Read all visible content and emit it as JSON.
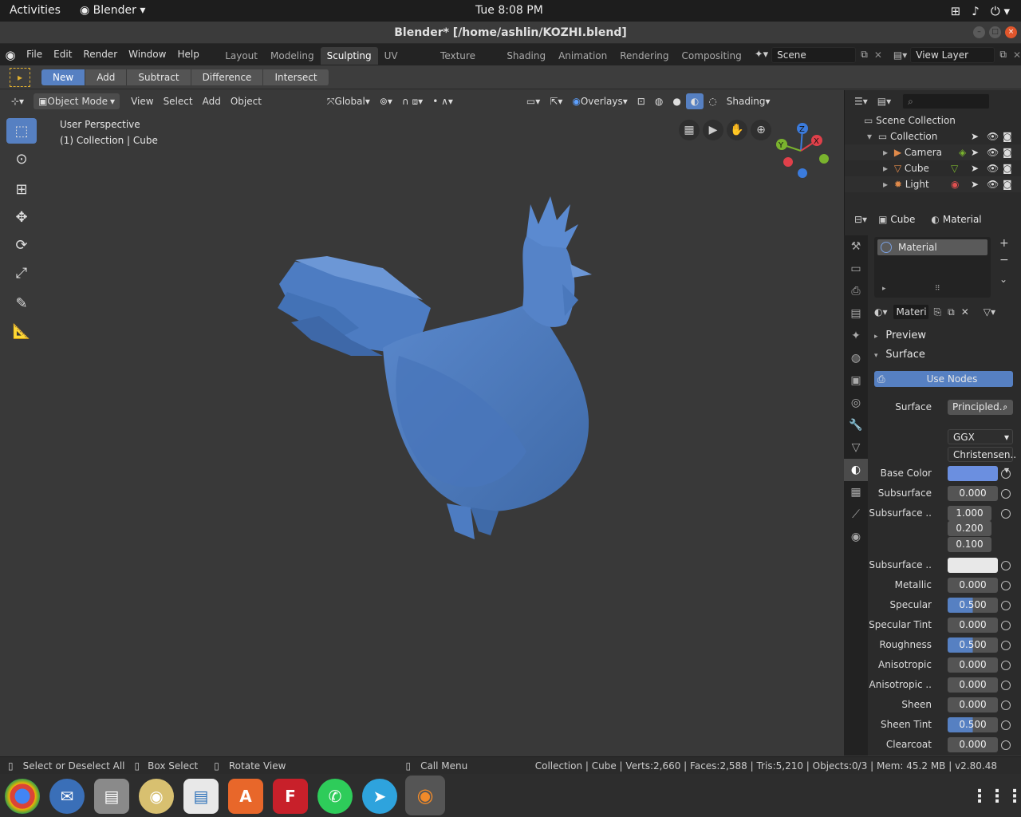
{
  "topbar": {
    "activities": "Activities",
    "app": "Blender",
    "clock": "Tue  8:08 PM"
  },
  "window": {
    "title": "Blender* [/home/ashlin/KOZHI.blend]"
  },
  "menu": [
    "File",
    "Edit",
    "Render",
    "Window",
    "Help"
  ],
  "workspaces": [
    "Layout",
    "Modeling",
    "Sculpting",
    "UV Editing",
    "Texture Paint",
    "Shading",
    "Animation",
    "Rendering",
    "Compositing"
  ],
  "scene": {
    "label": "Scene",
    "view_layer": "View Layer"
  },
  "toolheader": {
    "modes": [
      "New",
      "Add",
      "Subtract",
      "Difference",
      "Intersect"
    ]
  },
  "viewport_header": {
    "mode": "Object Mode",
    "menus": [
      "View",
      "Select",
      "Add",
      "Object"
    ],
    "orientation": "Global",
    "overlays": "Overlays",
    "shading": "Shading"
  },
  "viewport": {
    "line1": "User Perspective",
    "line2": "(1) Collection | Cube"
  },
  "outliner": {
    "root": "Scene Collection",
    "collection": "Collection",
    "items": [
      "Camera",
      "Cube",
      "Light"
    ]
  },
  "props": {
    "object": "Cube",
    "material_tab": "Material",
    "slot": "Material",
    "mat_name": "Materi",
    "preview": "Preview",
    "surface_section": "Surface",
    "use_nodes": "Use Nodes",
    "surface_label": "Surface",
    "surface_value": "Principled..",
    "distribution": "GGX",
    "subsurface_method": "Christensen..",
    "rows": [
      {
        "label": "Base Color",
        "value": ""
      },
      {
        "label": "Subsurface",
        "value": "0.000"
      },
      {
        "label": "Subsurface ..",
        "value": "1.000"
      },
      {
        "label": "",
        "value": "0.200"
      },
      {
        "label": "",
        "value": "0.100"
      },
      {
        "label": "Subsurface ..",
        "value": ""
      },
      {
        "label": "Metallic",
        "value": "0.000"
      },
      {
        "label": "Specular",
        "value": "0.500"
      },
      {
        "label": "Specular Tint",
        "value": "0.000"
      },
      {
        "label": "Roughness",
        "value": "0.500"
      },
      {
        "label": "Anisotropic",
        "value": "0.000"
      },
      {
        "label": "Anisotropic ..",
        "value": "0.000"
      },
      {
        "label": "Sheen",
        "value": "0.000"
      },
      {
        "label": "Sheen Tint",
        "value": "0.500"
      },
      {
        "label": "Clearcoat",
        "value": "0.000"
      }
    ]
  },
  "status": {
    "hint1": "Select or Deselect All",
    "hint2": "Box Select",
    "hint3": "Rotate View",
    "hint4": "Call Menu",
    "stats": "Collection | Cube | Verts:2,660 | Faces:2,588 | Tris:5,210 | Objects:0/3 | Mem: 45.2 MB | v2.80.48"
  },
  "colors": {
    "accent": "#5680c2",
    "base_color": "#6b8fe0",
    "mesh": "#4f7ec0"
  }
}
